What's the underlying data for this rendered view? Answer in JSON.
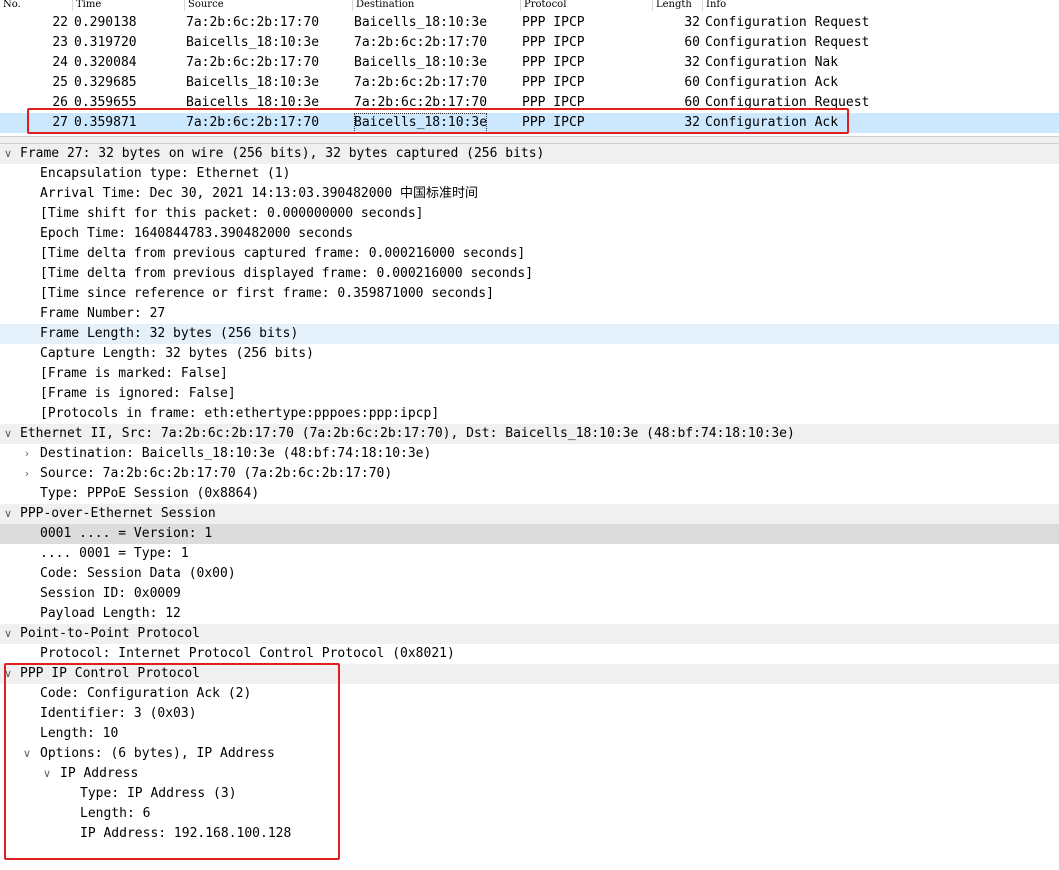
{
  "packet_list": {
    "columns": {
      "no": "No.",
      "time": "Time",
      "source": "Source",
      "destination": "Destination",
      "protocol": "Protocol",
      "length": "Length",
      "info": "Info"
    },
    "rows": [
      {
        "no": "22",
        "time": "0.290138",
        "source": "7a:2b:6c:2b:17:70",
        "destination": "Baicells_18:10:3e",
        "protocol": "PPP IPCP",
        "length": "32",
        "info": "Configuration Request"
      },
      {
        "no": "23",
        "time": "0.319720",
        "source": "Baicells_18:10:3e",
        "destination": "7a:2b:6c:2b:17:70",
        "protocol": "PPP IPCP",
        "length": "60",
        "info": "Configuration Request"
      },
      {
        "no": "24",
        "time": "0.320084",
        "source": "7a:2b:6c:2b:17:70",
        "destination": "Baicells_18:10:3e",
        "protocol": "PPP IPCP",
        "length": "32",
        "info": "Configuration Nak"
      },
      {
        "no": "25",
        "time": "0.329685",
        "source": "Baicells_18:10:3e",
        "destination": "7a:2b:6c:2b:17:70",
        "protocol": "PPP IPCP",
        "length": "60",
        "info": "Configuration Ack"
      },
      {
        "no": "26",
        "time": "0.359655",
        "source": "Baicells_18:10:3e",
        "destination": "7a:2b:6c:2b:17:70",
        "protocol": "PPP IPCP",
        "length": "60",
        "info": "Configuration Request"
      },
      {
        "no": "27",
        "time": "0.359871",
        "source": "7a:2b:6c:2b:17:70",
        "destination": "Baicells_18:10:3e",
        "protocol": "PPP IPCP",
        "length": "32",
        "info": "Configuration Ack"
      }
    ]
  },
  "detail_tree": {
    "frame": {
      "header": "Frame 27: 32 bytes on wire (256 bits), 32 bytes captured (256 bits)",
      "encapsulation": "Encapsulation type: Ethernet (1)",
      "arrival": "Arrival Time: Dec 30, 2021 14:13:03.390482000 中国标准时间",
      "time_shift": "[Time shift for this packet: 0.000000000 seconds]",
      "epoch": "Epoch Time: 1640844783.390482000 seconds",
      "delta_captured": "[Time delta from previous captured frame: 0.000216000 seconds]",
      "delta_displayed": "[Time delta from previous displayed frame: 0.000216000 seconds]",
      "since_reference": "[Time since reference or first frame: 0.359871000 seconds]",
      "number": "Frame Number: 27",
      "frame_length": "Frame Length: 32 bytes (256 bits)",
      "capture_length": "Capture Length: 32 bytes (256 bits)",
      "marked": "[Frame is marked: False]",
      "ignored": "[Frame is ignored: False]",
      "protocols": "[Protocols in frame: eth:ethertype:pppoes:ppp:ipcp]"
    },
    "ethernet": {
      "header": "Ethernet II, Src: 7a:2b:6c:2b:17:70 (7a:2b:6c:2b:17:70), Dst: Baicells_18:10:3e (48:bf:74:18:10:3e)",
      "destination": "Destination: Baicells_18:10:3e (48:bf:74:18:10:3e)",
      "source": "Source: 7a:2b:6c:2b:17:70 (7a:2b:6c:2b:17:70)",
      "type": "Type: PPPoE Session (0x8864)"
    },
    "pppoe": {
      "header": "PPP-over-Ethernet Session",
      "version": "0001 .... = Version: 1",
      "type": ".... 0001 = Type: 1",
      "code": "Code: Session Data (0x00)",
      "session_id": "Session ID: 0x0009",
      "payload_length": "Payload Length: 12"
    },
    "ppp": {
      "header": "Point-to-Point Protocol",
      "protocol": "Protocol: Internet Protocol Control Protocol (0x8021)"
    },
    "ipcp": {
      "header": "PPP IP Control Protocol",
      "code": "Code: Configuration Ack (2)",
      "identifier": "Identifier: 3 (0x03)",
      "length": "Length: 10",
      "options": "Options: (6 bytes), IP Address",
      "ip_option": "IP Address",
      "opt_type": "Type: IP Address (3)",
      "opt_length": "Length: 6",
      "ip_address": "IP Address: 192.168.100.128"
    }
  },
  "icons": {
    "expanded": "chevron-down-icon",
    "collapsed": "chevron-right-icon"
  },
  "colors": {
    "selected_row": "#cce8ff",
    "highlight_row": "#e4f1fb",
    "annotation": "#e02020"
  }
}
